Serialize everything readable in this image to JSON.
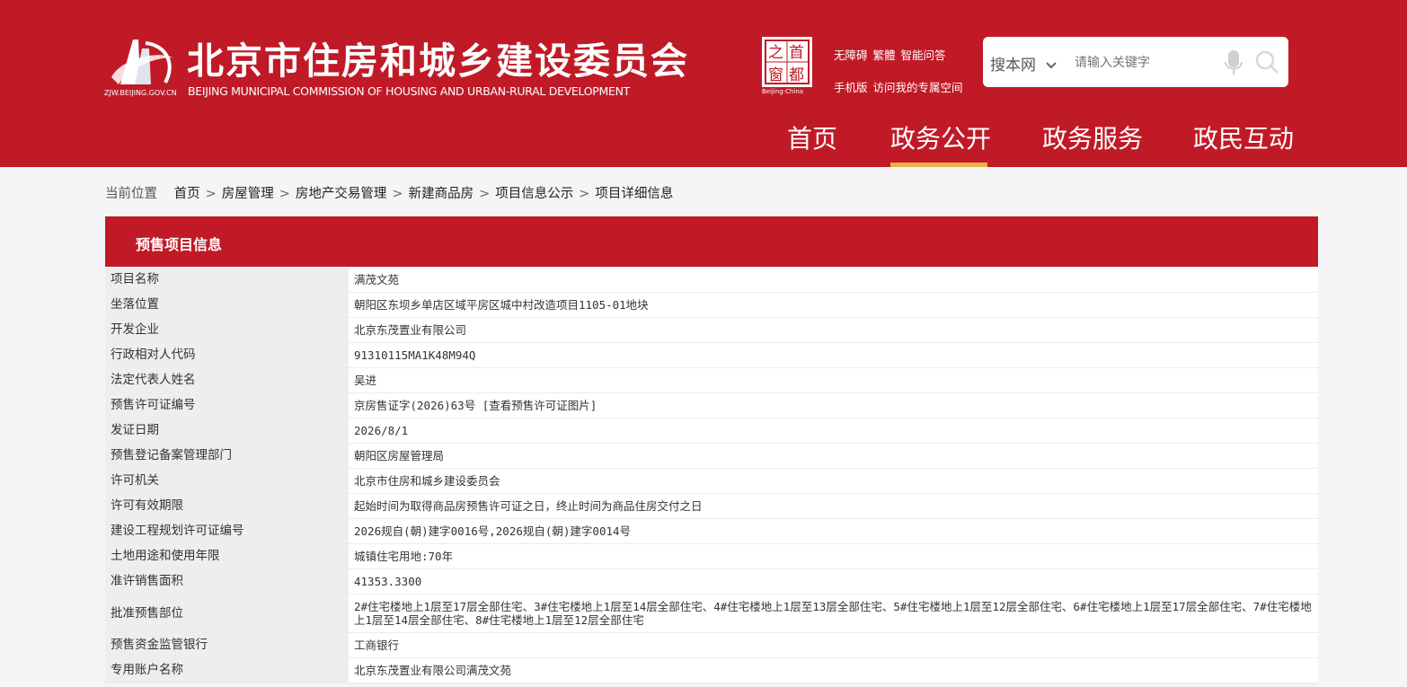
{
  "header": {
    "site_title": "北京市住房和城乡建设委员会",
    "site_subtitle": "BEIJING MUNICIPAL COMMISSION OF HOUSING AND URBAN-RURAL DEVELOPMENT",
    "logo_text": "ZJW.BEIJING.GOV.CN",
    "seal_chars": [
      "首",
      "都",
      "之",
      "窗"
    ],
    "seal_caption": "Beijing·China",
    "top_links_row1": [
      "无障碍",
      "繁體",
      "智能问答"
    ],
    "top_links_row2": [
      "手机版",
      "访问我的专属空间"
    ],
    "search_scope": "搜本网",
    "search_placeholder": "请输入关键字",
    "nav": [
      "首页",
      "政务公开",
      "政务服务",
      "政民互动"
    ],
    "active_nav": "政务公开",
    "brand_color": "#c01a27",
    "accent_color": "#e8b04a"
  },
  "breadcrumb": {
    "lead": "当前位置",
    "items": [
      "首页",
      "房屋管理",
      "房地产交易管理",
      "新建商品房",
      "项目信息公示",
      "项目详细信息"
    ],
    "separator": ">"
  },
  "panel": {
    "title": "预售项目信息",
    "rows": [
      {
        "key": "项目名称",
        "value": "满茂文苑"
      },
      {
        "key": "坐落位置",
        "value": "朝阳区东坝乡单店区域平房区城中村改造项目1105-01地块"
      },
      {
        "key": "开发企业",
        "value": "北京东茂置业有限公司"
      },
      {
        "key": "行政相对人代码",
        "value": "91310115MA1K48M94Q"
      },
      {
        "key": "法定代表人姓名",
        "value": "吴进"
      },
      {
        "key": "预售许可证编号",
        "value": "京房售证字(2026)63号",
        "link": "[查看预售许可证图片]"
      },
      {
        "key": "发证日期",
        "value": "2026/8/1"
      },
      {
        "key": "预售登记备案管理部门",
        "value": "朝阳区房屋管理局"
      },
      {
        "key": "许可机关",
        "value": "北京市住房和城乡建设委员会"
      },
      {
        "key": "许可有效期限",
        "value": "起始时间为取得商品房预售许可证之日，终止时间为商品住房交付之日"
      },
      {
        "key": "建设工程规划许可证编号",
        "value": "2026规自(朝)建字0016号,2026规自(朝)建字0014号"
      },
      {
        "key": "土地用途和使用年限",
        "value": "城镇住宅用地:70年"
      },
      {
        "key": "准许销售面积",
        "value": "41353.3300"
      },
      {
        "key": "批准预售部位",
        "value": "2#住宅楼地上1层至17层全部住宅、3#住宅楼地上1层至14层全部住宅、4#住宅楼地上1层至13层全部住宅、5#住宅楼地上1层至12层全部住宅、6#住宅楼地上1层至17层全部住宅、7#住宅楼地上1层至14层全部住宅、8#住宅楼地上1层至12层全部住宅"
      },
      {
        "key": "预售资金监管银行",
        "value": "工商银行"
      },
      {
        "key": "专用账户名称",
        "value": "北京东茂置业有限公司满茂文苑"
      }
    ]
  }
}
